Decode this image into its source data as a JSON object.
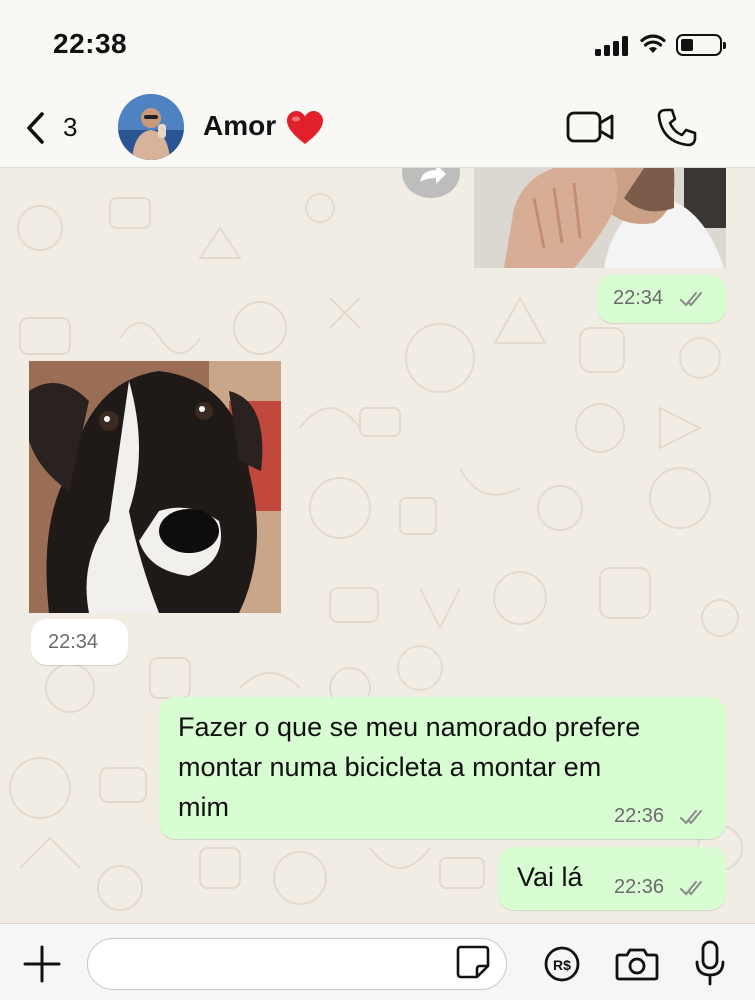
{
  "status_bar": {
    "time": "22:38"
  },
  "header": {
    "back_count": "3",
    "contact_name": "Amor"
  },
  "messages": [
    {
      "id": "m1",
      "type": "image",
      "direction": "outgoing",
      "time": "22:34",
      "ticks": "read"
    },
    {
      "id": "m2",
      "type": "sticker",
      "direction": "incoming",
      "time": "22:34"
    },
    {
      "id": "m3",
      "type": "text",
      "direction": "outgoing",
      "lines": [
        "Fazer o que se meu namorado prefere",
        "montar numa bicicleta a montar em",
        "mim"
      ],
      "time": "22:36",
      "ticks": "read"
    },
    {
      "id": "m4",
      "type": "text",
      "direction": "outgoing",
      "lines": [
        "Vai lá"
      ],
      "time": "22:36",
      "ticks": "read"
    }
  ],
  "input_bar": {
    "placeholder": ""
  },
  "icons": [
    "back-chevron-icon",
    "avatar",
    "heart-emoji",
    "video-call-icon",
    "phone-call-icon",
    "forward-icon",
    "double-check-icon",
    "plus-icon",
    "sticker-icon",
    "pix-payment-icon",
    "camera-icon",
    "microphone-icon"
  ],
  "colors": {
    "outgoing_bubble": "#d9fdd3",
    "incoming_bubble": "#ffffff",
    "chat_background": "#f2ede4",
    "read_ticks": "#8a8a8a"
  }
}
